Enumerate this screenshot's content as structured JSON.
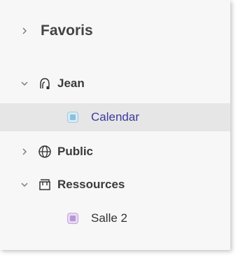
{
  "tree": {
    "favoris": {
      "label": "Favoris",
      "chevron": "chevron-right-icon"
    },
    "jean": {
      "label": "Jean",
      "chevron": "chevron-down-icon",
      "icon": "user-icon"
    },
    "calendar": {
      "label": "Calendar",
      "icon": "calendar-square-icon",
      "color": "#a9d3e8"
    },
    "public": {
      "label": "Public",
      "chevron": "chevron-right-icon",
      "icon": "globe-icon"
    },
    "ressources": {
      "label": "Ressources",
      "chevron": "chevron-down-icon",
      "icon": "resources-icon"
    },
    "salle2": {
      "label": "Salle 2",
      "icon": "calendar-square-icon",
      "color": "#cdb4e2"
    }
  },
  "colors": {
    "selected_bg": "#e6e6e6",
    "calendar_label": "#3b3aa0"
  }
}
